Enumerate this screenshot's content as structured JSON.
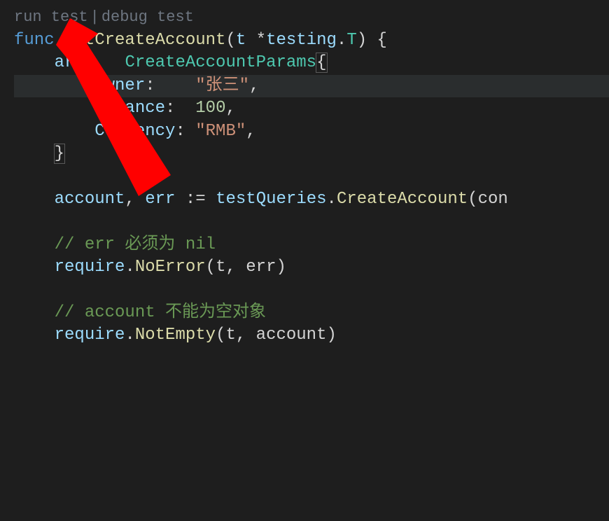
{
  "codelens": {
    "run": "run test",
    "sep": "|",
    "debug": "debug test"
  },
  "code": {
    "func": "func",
    "ws0": " ",
    "fn": "estCreateAccount",
    "openParen": "(",
    "paramT": "t",
    "ws1": " ",
    "star": "*",
    "pkgTesting": "testing",
    "dot0": ".",
    "typeT": "T",
    "closeParenSp": ") ",
    "lbrace": "{",
    "indent1": "    ",
    "arg": "arg",
    "assignGap": "    ",
    "typeParams": "CreateAccountParams",
    "lbrace2": "{",
    "indent2": "        ",
    "fOwner": "Owner",
    "colon": ":",
    "valGap0": "    ",
    "strOwner": "\"张三\"",
    "comma": ",",
    "fBalance": "Balance",
    "valGap1": "  ",
    "numBalance": "100",
    "fCurrency": "Currency",
    "valGap2": " ",
    "strCurrency": "\"RMB\"",
    "closeStruct": "}",
    "acct": "account",
    "err": "err",
    "opAssign": ":=",
    "qvar": "testQueries",
    "mCreate": "CreateAccount",
    "callTail": "(con",
    "cmt1": "// err 必须为 nil",
    "req": "require",
    "mNoErr": "NoError",
    "argsNoErr": "(t, err)",
    "cmt2": "// account 不能为空对象",
    "mNotEmpty": "NotEmpty",
    "argsNotEmpty": "(t, account)"
  }
}
